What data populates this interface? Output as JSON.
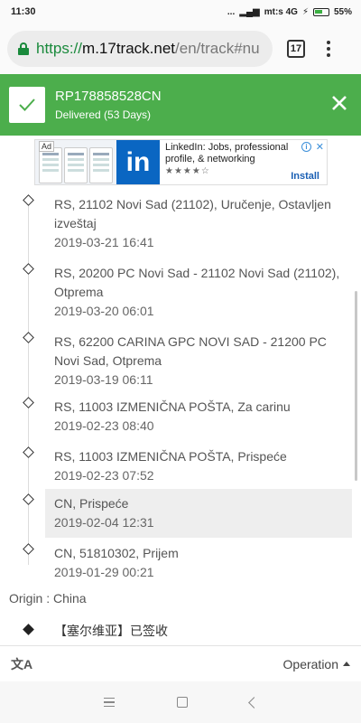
{
  "status_bar": {
    "time": "11:30",
    "dots": "...",
    "carrier": "mt:s 4G",
    "battery": "55%"
  },
  "browser": {
    "url_scheme": "https://",
    "url_host": "m.17track.net",
    "url_path": "/en/track#nu",
    "tab_count": "17"
  },
  "header": {
    "tracking_number": "RP178858528CN",
    "status": "Delivered (53 Days)"
  },
  "ad": {
    "label": "Ad",
    "logo_text": "in",
    "title": "LinkedIn: Jobs, professional profile, & networking",
    "stars": "★★★★☆",
    "install": "Install",
    "info": "i",
    "close": "✕"
  },
  "events": [
    {
      "desc": "RS, 21102 Novi Sad (21102), Uručenje, Ostavljen izveštaj",
      "date": "2019-03-21 16:41"
    },
    {
      "desc": "RS, 20200 PC Novi Sad - 21102 Novi Sad (21102), Otprema",
      "date": "2019-03-20 06:01"
    },
    {
      "desc": "RS, 62200 CARINA GPC NOVI SAD - 21200 PC Novi Sad, Otprema",
      "date": "2019-03-19 06:11"
    },
    {
      "desc": "RS, 11003 IZMENIČNA POŠTA, Za carinu",
      "date": "2019-02-23 08:40"
    },
    {
      "desc": "RS, 11003 IZMENIČNA POŠTA, Prispeće",
      "date": "2019-02-23 07:52"
    },
    {
      "desc": "CN, Prispeće",
      "date": "2019-02-04 12:31"
    },
    {
      "desc": "CN, 51810302, Prijem",
      "date": "2019-01-29 00:21"
    }
  ],
  "origin": "Origin : China",
  "origin_event": "【塞尔维亚】已签收",
  "bottom": {
    "translate_icon": "文A",
    "operation": "Operation"
  }
}
